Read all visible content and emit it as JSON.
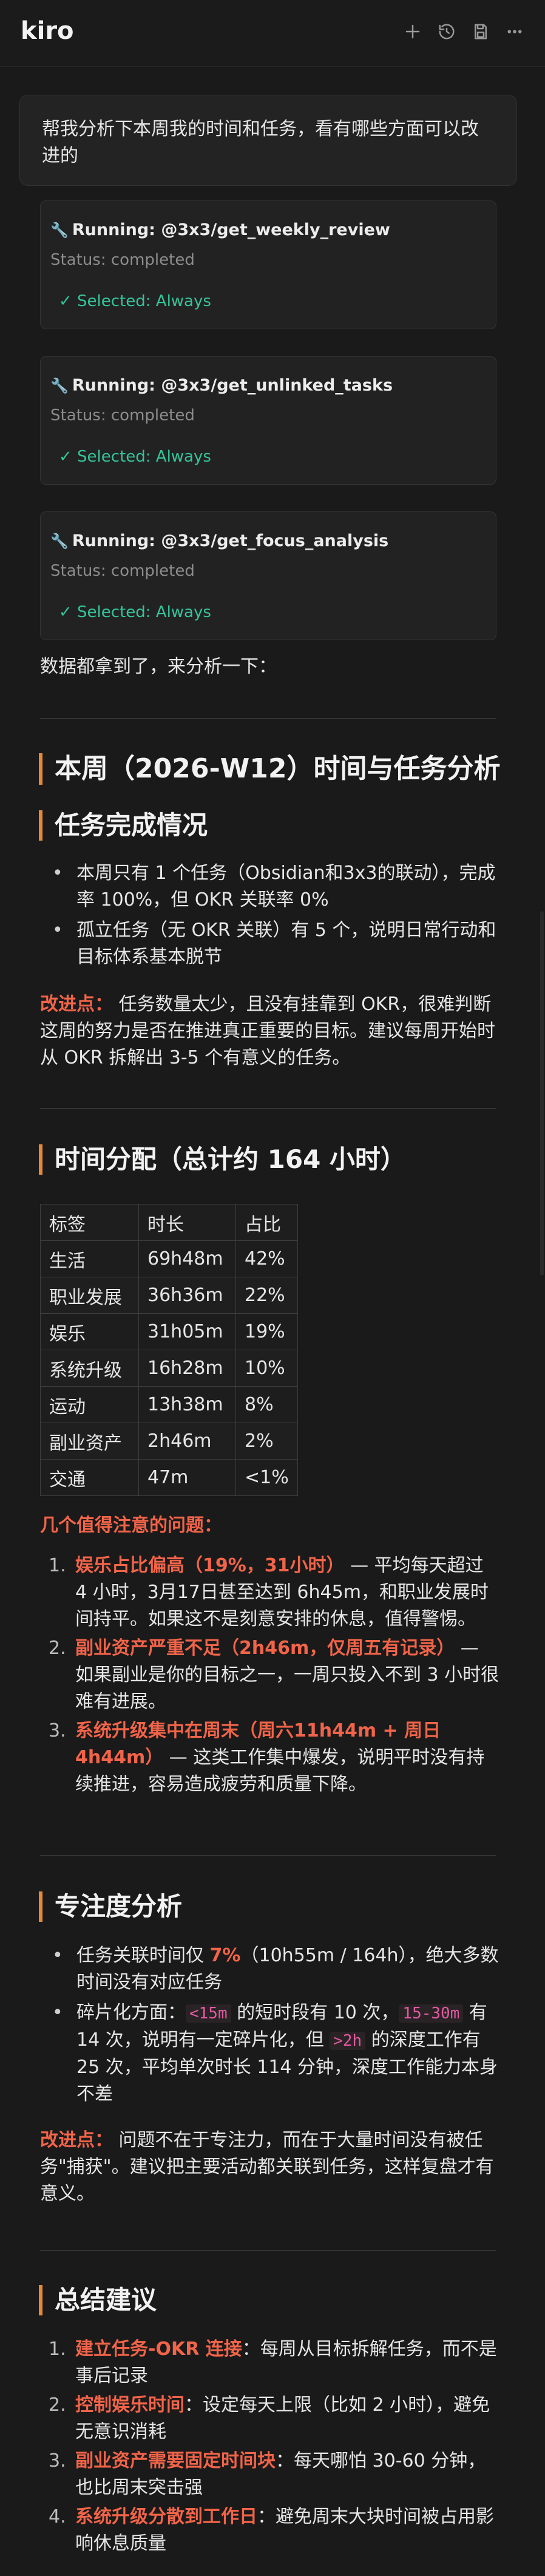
{
  "header": {
    "brand": "kiro",
    "icons": [
      "plus-icon",
      "history-icon",
      "save-icon",
      "more-icon"
    ]
  },
  "user_message": "帮我分析下本周我的时间和任务，看有哪些方面可以改进的",
  "tool_calls": [
    {
      "name": "Running: @3x3/get_weekly_review",
      "status": "Status: completed",
      "selected": "✓ Selected: Always"
    },
    {
      "name": "Running: @3x3/get_unlinked_tasks",
      "status": "Status: completed",
      "selected": "✓ Selected: Always"
    },
    {
      "name": "Running: @3x3/get_focus_analysis",
      "status": "Status: completed",
      "selected": "✓ Selected: Always"
    }
  ],
  "intro": "数据都拿到了，来分析一下：",
  "report": {
    "title": "本周（2026-W12）时间与任务分析",
    "task_section": {
      "heading": "任务完成情况",
      "bullets": [
        "本周只有 1 个任务（Obsidian和3x3的联动），完成率 100%，但 OKR 关联率 0%",
        "孤立任务（无 OKR 关联）有 5 个，说明日常行动和目标体系基本脱节"
      ],
      "improve_label": "改进点：",
      "improve_text": " 任务数量太少，且没有挂靠到 OKR，很难判断这周的努力是否在推进真正重要的目标。建议每周开始时从 OKR 拆解出 3-5 个有意义的任务。"
    },
    "time_section": {
      "heading": "时间分配（总计约 164 小时）",
      "table_headers": [
        "标签",
        "时长",
        "占比"
      ],
      "rows": [
        [
          "生活",
          "69h48m",
          "42%"
        ],
        [
          "职业发展",
          "36h36m",
          "22%"
        ],
        [
          "娱乐",
          "31h05m",
          "19%"
        ],
        [
          "系统升级",
          "16h28m",
          "10%"
        ],
        [
          "运动",
          "13h38m",
          "8%"
        ],
        [
          "副业资产",
          "2h46m",
          "2%"
        ],
        [
          "交通",
          "47m",
          "<1%"
        ]
      ],
      "issues_label": "几个值得注意的问题：",
      "issues": [
        {
          "n": "1.",
          "bold": "娱乐占比偏高（19%，31小时）",
          "text": " — 平均每天超过 4 小时，3月17日甚至达到 6h45m，和职业发展时间持平。如果这不是刻意安排的休息，值得警惕。"
        },
        {
          "n": "2.",
          "bold": "副业资产严重不足（2h46m，仅周五有记录）",
          "text": " — 如果副业是你的目标之一，一周只投入不到 3 小时很难有进展。"
        },
        {
          "n": "3.",
          "bold": "系统升级集中在周末（周六11h44m + 周日 4h44m）",
          "text": " — 这类工作集中爆发，说明平时没有持续推进，容易造成疲劳和质量下降。"
        }
      ]
    },
    "focus_section": {
      "heading": "专注度分析",
      "b1_pre": "任务关联时间仅 ",
      "b1_red": "7%",
      "b1_post": "（10h55m / 164h），绝大多数时间没有对应任务",
      "b2_pre": "碎片化方面：",
      "b2_c1": "<15m",
      "b2_mid1": " 的短时段有 10 次，",
      "b2_c2": "15-30m",
      "b2_mid2": " 有 14 次，说明有一定碎片化，但 ",
      "b2_c3": ">2h",
      "b2_post": " 的深度工作有 25 次，平均单次时长 114 分钟，深度工作能力本身不差",
      "improve_label": "改进点：",
      "improve_text": " 问题不在于专注力，而在于大量时间没有被任务\"捕获\"。建议把主要活动都关联到任务，这样复盘才有意义。"
    },
    "summary_section": {
      "heading": "总结建议",
      "items": [
        {
          "n": "1.",
          "bold": "建立任务-OKR 连接",
          "text": "：每周从目标拆解任务，而不是事后记录"
        },
        {
          "n": "2.",
          "bold": "控制娱乐时间",
          "text": "：设定每天上限（比如 2 小时），避免无意识消耗"
        },
        {
          "n": "3.",
          "bold": "副业资产需要固定时间块",
          "text": "：每天哪怕 30-60 分钟，也比周末突击强"
        },
        {
          "n": "4.",
          "bold": "系统升级分散到工作日",
          "text": "：避免周末大块时间被占用影响休息质量"
        }
      ]
    }
  },
  "colors": {
    "accent": "#e8893a",
    "emphasis": "#f26449",
    "success": "#35c49a",
    "code": "#e05aa0"
  }
}
